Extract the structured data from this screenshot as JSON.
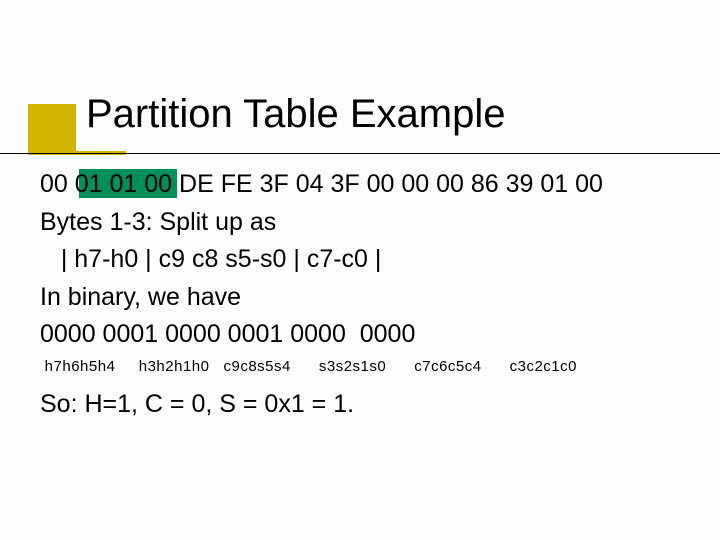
{
  "title": "Partition Table Example",
  "hex": "00 01 01 00 DE FE 3F 04 3F 00 00 00 86 39 01 00",
  "bytes_label": "Bytes 1-3: Split up as",
  "field_spec": "   | h7-h0 | c9 c8 s5-s0 | c7-c0 |",
  "binary_label": "In binary, we have",
  "binary_value": "0000 0001 0000 0001 0000  0000",
  "binary_columns": " h7h6h5h4     h3h2h1h0   c9c8s5s4      s3s2s1s0      c7c6c5c4      c3c2c1c0",
  "conclusion": "So: H=1, C = 0, S = 0x1 = 1."
}
